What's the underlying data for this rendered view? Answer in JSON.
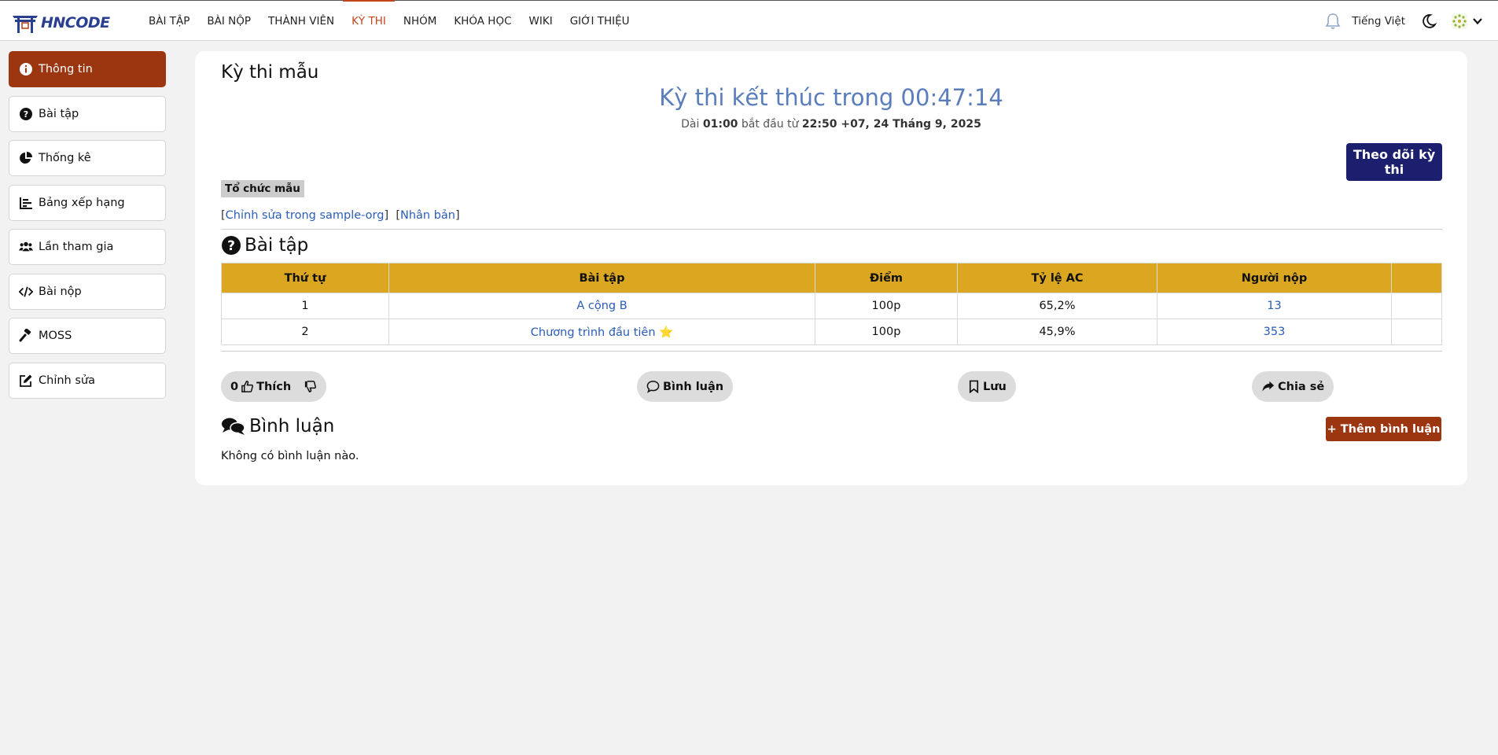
{
  "app": {
    "logo_text": "HNCODE",
    "nav": [
      "BÀI TẬP",
      "BÀI NỘP",
      "THÀNH VIÊN",
      "KỲ THI",
      "NHÓM",
      "KHÓA HỌC",
      "WIKI",
      "GIỚI THIỆU"
    ],
    "active_nav": "KỲ THI",
    "language": "Tiếng Việt"
  },
  "sidebar": {
    "items": [
      {
        "label": "Thông tin",
        "icon": "info-icon",
        "active": true
      },
      {
        "label": "Bài tập",
        "icon": "question-circle-icon"
      },
      {
        "label": "Thống kê",
        "icon": "pie-chart-icon"
      },
      {
        "label": "Bảng xếp hạng",
        "icon": "bar-chart-icon"
      },
      {
        "label": "Lần tham gia",
        "icon": "users-icon"
      },
      {
        "label": "Bài nộp",
        "icon": "code-icon"
      },
      {
        "label": "MOSS",
        "icon": "gavel-icon"
      },
      {
        "label": "Chỉnh sửa",
        "icon": "edit-icon"
      }
    ]
  },
  "contest": {
    "title": "Kỳ thi mẫu",
    "timer_label": "Kỳ thi kết thúc trong ",
    "timer_value": "00:47:14",
    "duration_prefix": "Dài ",
    "duration": "01:00",
    "start_prefix": " bắt đầu từ ",
    "start": "22:50 +07, 24 Tháng 9, 2025",
    "follow_label": "Theo dõi kỳ thi",
    "org_tag": "Tổ chức mẫu",
    "edit_link": "Chỉnh sửa trong sample-org",
    "clone_link": "Nhân bản"
  },
  "problems": {
    "heading": "Bài tập",
    "columns": [
      "Thứ tự",
      "Bài tập",
      "Điểm",
      "Tỷ lệ AC",
      "Người nộp",
      ""
    ],
    "rows": [
      {
        "order": "1",
        "name": "A cộng B",
        "points": "100p",
        "ac_rate": "65,2%",
        "submitters": "13"
      },
      {
        "order": "2",
        "name": "Chương trình đầu tiên ⭐",
        "points": "100p",
        "ac_rate": "45,9%",
        "submitters": "353"
      }
    ]
  },
  "actions": {
    "likes": "0",
    "like_label": "Thích",
    "comment_label": "Bình luận",
    "save_label": "Lưu",
    "share_label": "Chia sẻ"
  },
  "comments": {
    "heading": "Bình luận",
    "add_label": "+ Thêm bình luận",
    "empty_text": "Không có bình luận nào."
  },
  "colors": {
    "accent": "#9b3611",
    "nav_active": "#c0451c",
    "table_header": "#dba721",
    "follow_button": "#1b1f6e",
    "timer": "#5a7dbc",
    "link": "#2a5cb8"
  }
}
